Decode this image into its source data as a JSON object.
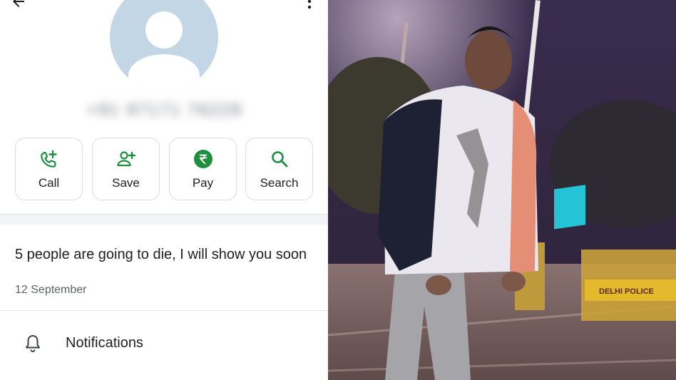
{
  "header": {
    "back_icon": "arrow-back-icon",
    "more_icon": "more-vert-icon"
  },
  "contact": {
    "name": "+91 97171 76229",
    "avatar_icon": "person-placeholder-icon"
  },
  "actions": [
    {
      "label": "Call",
      "icon": "add-call-icon"
    },
    {
      "label": "Save",
      "icon": "person-add-icon"
    },
    {
      "label": "Pay",
      "icon": "rupee-icon"
    },
    {
      "label": "Search",
      "icon": "search-icon"
    }
  ],
  "status": {
    "text": "5 people are going to die, I will show you soon",
    "date": "12 September"
  },
  "notifications": {
    "label": "Notifications",
    "icon": "bell-icon"
  },
  "photo": {
    "sign_text": "DELHI POLICE"
  },
  "colors": {
    "accent_green": "#1e8e3e",
    "avatar_bg": "#c3d6e6",
    "text_primary": "#1f1f1f",
    "text_secondary": "#5f6368"
  }
}
